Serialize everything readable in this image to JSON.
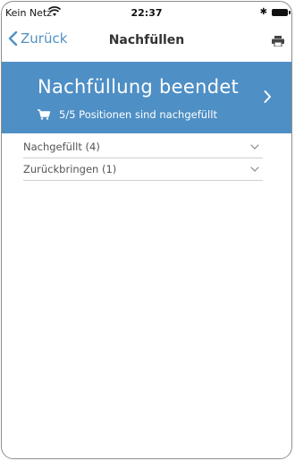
{
  "status_bar": {
    "carrier": "Kein Netz",
    "time": "22:37",
    "bluetooth": "✱"
  },
  "nav": {
    "back_label": "Zurück",
    "title": "Nachfüllen"
  },
  "banner": {
    "title": "Nachfüllung beendet",
    "subtitle": "5/5 Positionen sind nachgefüllt"
  },
  "sections": [
    {
      "label": "Nachgefüllt (4)"
    },
    {
      "label": "Zurückbringen (1)"
    }
  ],
  "colors": {
    "accent": "#4e8fc5",
    "link": "#4f91c4"
  },
  "icons": [
    "wifi-icon",
    "bluetooth-icon",
    "battery-icon",
    "back-chevron-icon",
    "print-icon",
    "cart-icon",
    "chevron-right-icon",
    "chevron-down-icon"
  ]
}
